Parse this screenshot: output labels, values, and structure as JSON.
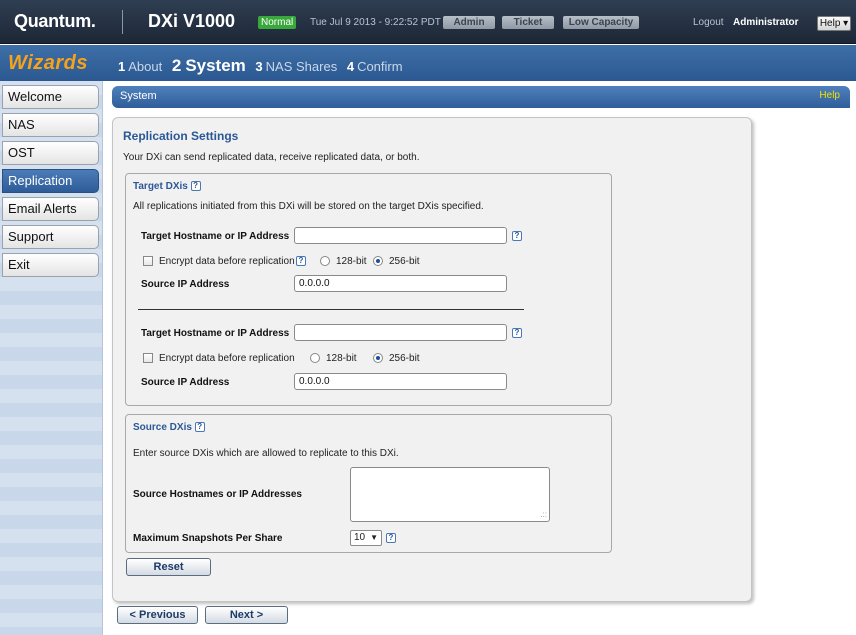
{
  "header": {
    "brand": "Quantum.",
    "product": "DXi V1000",
    "status": "Normal",
    "datetime": "Tue Jul 9 2013 - 9:22:52 PDT",
    "pills": [
      "Admin",
      "Ticket",
      "Low Capacity"
    ],
    "logout": "Logout",
    "user": "Administrator",
    "help": "Help ▾"
  },
  "wizard": {
    "title": "Wizards",
    "steps": [
      {
        "num": "1",
        "label": "About"
      },
      {
        "num": "2",
        "label": "System"
      },
      {
        "num": "3",
        "label": "NAS Shares"
      },
      {
        "num": "4",
        "label": "Confirm"
      }
    ],
    "active_step": "System"
  },
  "sidebar": {
    "items": [
      "Welcome",
      "NAS",
      "OST",
      "Replication",
      "Email Alerts",
      "Support",
      "Exit"
    ],
    "active": "Replication"
  },
  "main": {
    "header_title": "System",
    "header_help": "Help",
    "title": "Replication Settings",
    "description": "Your DXi can send replicated data, receive replicated data, or both.",
    "target": {
      "title": "Target DXis",
      "description": "All replications initiated from this DXi will be stored on the target DXis specified.",
      "hostname_label": "Target Hostname or IP Address",
      "encrypt_label": "Encrypt data before replication",
      "opt_128": "128-bit",
      "opt_256": "256-bit",
      "source_ip_label": "Source IP Address",
      "entries": [
        {
          "hostname": "",
          "encrypt": false,
          "bits": "256-bit",
          "source_ip": "0.0.0.0"
        },
        {
          "hostname": "",
          "encrypt": false,
          "bits": "256-bit",
          "source_ip": "0.0.0.0"
        }
      ]
    },
    "source": {
      "title": "Source DXis",
      "description": "Enter source DXis which are allowed to replicate to this DXi.",
      "hostnames_label": "Source Hostnames or IP Addresses",
      "hostnames_value": "",
      "snapshots_label": "Maximum Snapshots Per Share",
      "snapshots_value": "10"
    },
    "reset_label": "Reset"
  },
  "footer": {
    "previous_label": "< Previous",
    "next_label": "Next >"
  }
}
